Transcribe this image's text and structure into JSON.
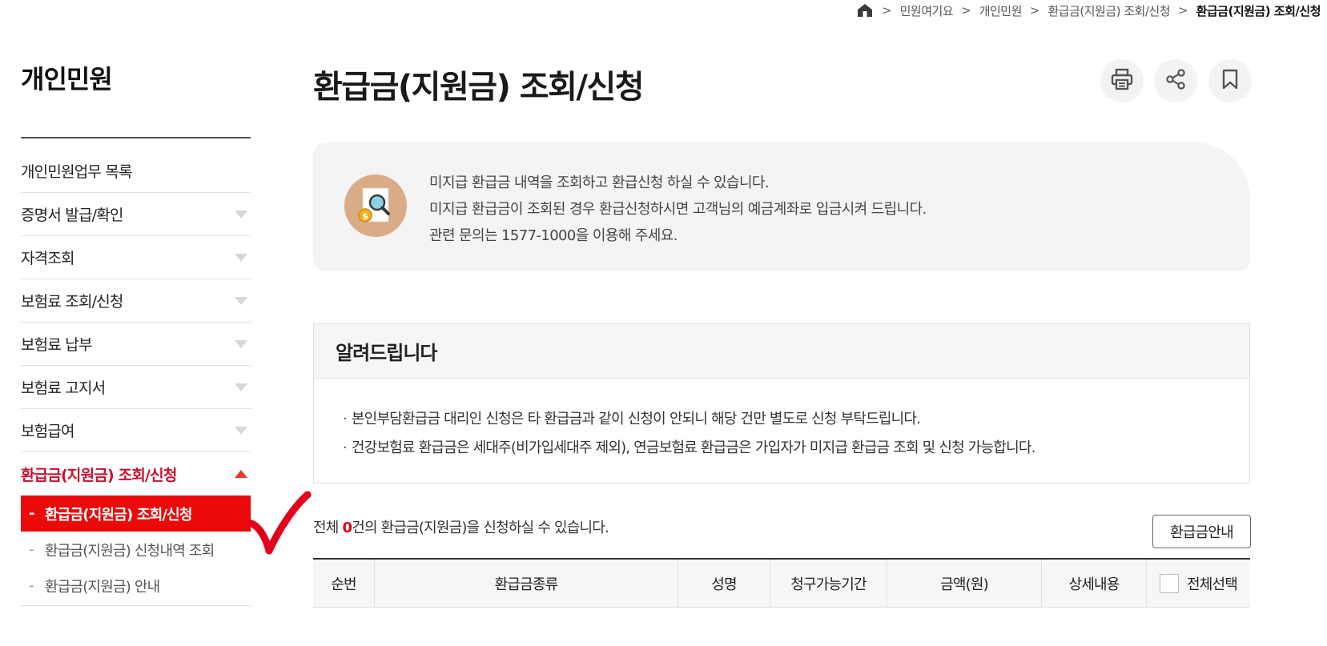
{
  "breadcrumb": {
    "home_icon": "home-icon",
    "items": [
      "민원여기요",
      "개인민원",
      "환급금(지원금) 조회/신청",
      "환급금(지원금) 조회/신청"
    ]
  },
  "sidebar": {
    "title": "개인민원",
    "items": [
      {
        "label": "개인민원업무 목록",
        "has_arrow": false
      },
      {
        "label": "증명서 발급/확인",
        "has_arrow": true
      },
      {
        "label": "자격조회",
        "has_arrow": true
      },
      {
        "label": "보험료 조회/신청",
        "has_arrow": true
      },
      {
        "label": "보험료 납부",
        "has_arrow": true
      },
      {
        "label": "보험료 고지서",
        "has_arrow": true
      },
      {
        "label": "보험급여",
        "has_arrow": true
      },
      {
        "label": "환급금(지원금) 조회/신청",
        "has_arrow": true,
        "active": true
      }
    ],
    "sub_items": [
      {
        "label": "환급금(지원금) 조회/신청",
        "active": true
      },
      {
        "label": "환급금(지원금) 신청내역 조회",
        "active": false
      },
      {
        "label": "환급금(지원금) 안내",
        "active": false
      }
    ],
    "sub_dash": "-"
  },
  "page": {
    "title": "환급금(지원금) 조회/신청",
    "tools": [
      "print-icon",
      "share-icon",
      "bookmark-icon"
    ]
  },
  "info": {
    "icon": "document-search-coin-icon",
    "lines": [
      "미지급 환급금 내역을 조회하고 환급신청 하실 수 있습니다.",
      "미지급 환급금이 조회된 경우 환급신청하시면 고객님의 예금계좌로 입금시켜 드립니다.",
      "관련 문의는 1577-1000을 이용해 주세요."
    ]
  },
  "notice": {
    "title": "알려드립니다",
    "bullet": "·",
    "items": [
      "본인부담환급금 대리인 신청은 타 환급금과 같이 신청이 안되니 해당 건만 별도로 신청 부탁드립니다.",
      "건강보험료 환급금은 세대주(비가입세대주 제외), 연금보험료 환급금은 가입자가 미지급 환급금 조회 및 신청 가능합니다."
    ]
  },
  "summary": {
    "prefix": "전체 ",
    "count": "0",
    "suffix": "건의 환급금(지원금)을 신청하실 수 있습니다."
  },
  "guide_button": "환급금안내",
  "table": {
    "headers": [
      "순번",
      "환급금종류",
      "성명",
      "청구가능기간",
      "금액(원)",
      "상세내용",
      "전체선택"
    ]
  },
  "colors": {
    "accent_red": "#ea0a0a",
    "active_text": "#c8102e",
    "info_bg": "#f4f4f4",
    "check_mark": "#e3001b"
  }
}
